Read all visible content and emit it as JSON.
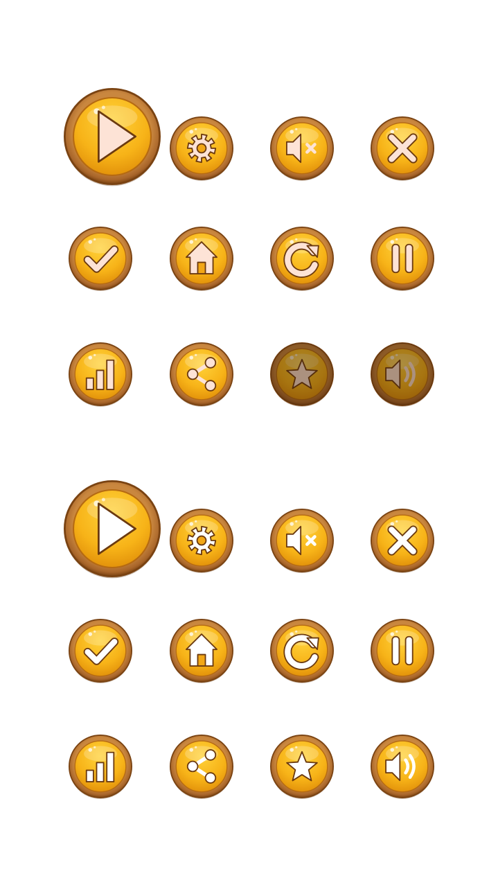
{
  "colors": {
    "wood_dark": "#7a4312",
    "wood_mid": "#a8652a",
    "wood_light": "#c9873f",
    "gold_light": "#ffd23a",
    "gold_mid": "#f7b318",
    "gold_dark": "#e3930b",
    "glyph_default": "#fde3d6",
    "glyph_sheet_2": "#ffffff"
  },
  "sets": [
    {
      "name": "set-a",
      "glyph_fill": "#fde3d6",
      "buttons": [
        {
          "name": "play",
          "icon": "play-icon",
          "size": "large"
        },
        {
          "name": "settings",
          "icon": "gear-icon"
        },
        {
          "name": "mute",
          "icon": "sound-off-icon"
        },
        {
          "name": "close",
          "icon": "close-icon"
        },
        {
          "name": "confirm",
          "icon": "check-icon"
        },
        {
          "name": "home",
          "icon": "home-icon"
        },
        {
          "name": "restart",
          "icon": "restart-icon"
        },
        {
          "name": "pause",
          "icon": "pause-icon"
        },
        {
          "name": "stats",
          "icon": "stats-icon"
        },
        {
          "name": "share",
          "icon": "share-icon"
        },
        {
          "name": "rate",
          "icon": "star-icon",
          "state": "disabled"
        },
        {
          "name": "sound",
          "icon": "sound-on-icon",
          "state": "disabled"
        }
      ]
    },
    {
      "name": "set-b",
      "glyph_fill": "#ffffff",
      "buttons": [
        {
          "name": "play",
          "icon": "play-icon",
          "size": "large"
        },
        {
          "name": "settings",
          "icon": "gear-icon"
        },
        {
          "name": "mute",
          "icon": "sound-off-icon"
        },
        {
          "name": "close",
          "icon": "close-icon"
        },
        {
          "name": "confirm",
          "icon": "check-icon"
        },
        {
          "name": "home",
          "icon": "home-icon"
        },
        {
          "name": "restart",
          "icon": "restart-icon"
        },
        {
          "name": "pause",
          "icon": "pause-icon"
        },
        {
          "name": "stats",
          "icon": "stats-icon"
        },
        {
          "name": "share",
          "icon": "share-icon"
        },
        {
          "name": "rate",
          "icon": "star-icon"
        },
        {
          "name": "sound",
          "icon": "sound-on-icon"
        }
      ]
    }
  ]
}
